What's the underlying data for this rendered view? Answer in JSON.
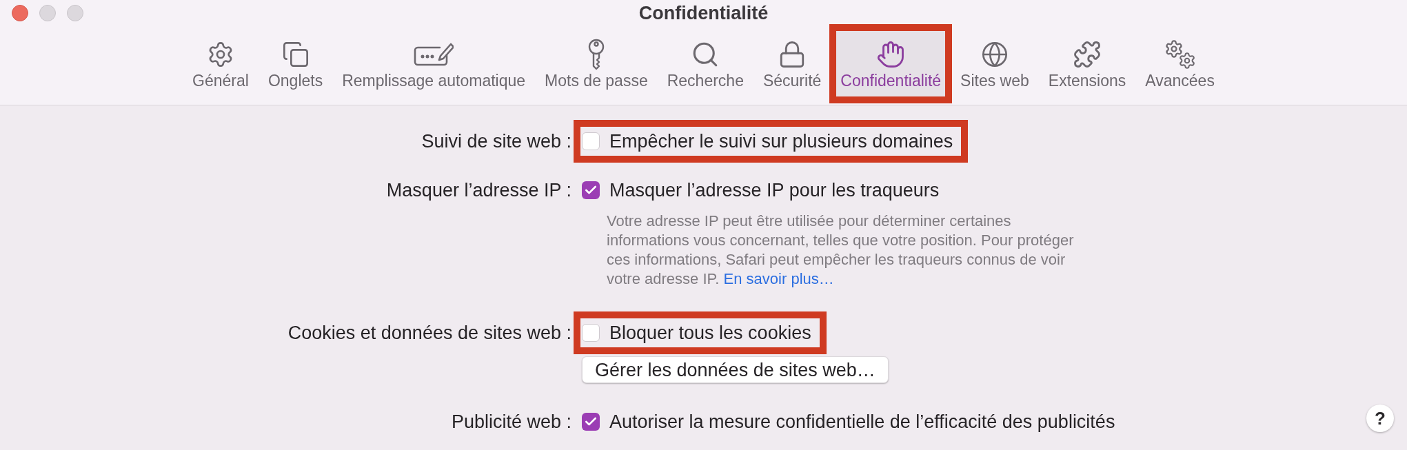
{
  "window": {
    "title": "Confidentialité"
  },
  "toolbar": {
    "tabs": [
      {
        "label": "Général",
        "selected": false,
        "highlighted": false
      },
      {
        "label": "Onglets",
        "selected": false,
        "highlighted": false
      },
      {
        "label": "Remplissage automatique",
        "selected": false,
        "highlighted": false
      },
      {
        "label": "Mots de passe",
        "selected": false,
        "highlighted": false
      },
      {
        "label": "Recherche",
        "selected": false,
        "highlighted": false
      },
      {
        "label": "Sécurité",
        "selected": false,
        "highlighted": false
      },
      {
        "label": "Confidentialité",
        "selected": true,
        "highlighted": true
      },
      {
        "label": "Sites web",
        "selected": false,
        "highlighted": false
      },
      {
        "label": "Extensions",
        "selected": false,
        "highlighted": false
      },
      {
        "label": "Avancées",
        "selected": false,
        "highlighted": false
      }
    ]
  },
  "settings": [
    {
      "label": "Suivi de site web :",
      "options": [
        {
          "kind": "checkbox",
          "label": "Empêcher le suivi sur plusieurs domaines",
          "checked": false,
          "highlighted": true
        }
      ]
    },
    {
      "label": "Masquer l’adresse IP :",
      "options": [
        {
          "kind": "checkbox",
          "label": "Masquer l’adresse IP pour les traqueurs",
          "checked": true,
          "highlighted": false
        },
        {
          "kind": "note",
          "lines": [
            "Votre adresse IP peut être utilisée pour déterminer certaines",
            "informations vous concernant, telles que votre position. Pour protéger",
            "ces informations, Safari peut empêcher les traqueurs connus de voir",
            "votre adresse IP."
          ],
          "link": "En savoir plus…"
        }
      ]
    },
    {
      "label": "Cookies et données de sites web :",
      "options": [
        {
          "kind": "checkbox",
          "label": "Bloquer tous les cookies",
          "checked": false,
          "highlighted": true
        },
        {
          "kind": "button",
          "label": "Gérer les données de sites web…"
        }
      ]
    },
    {
      "label": "Publicité web :",
      "options": [
        {
          "kind": "checkbox",
          "label": "Autoriser la mesure confidentielle de l’efficacité des publicités",
          "checked": true,
          "highlighted": false
        }
      ]
    }
  ],
  "help_button": {
    "label": "?"
  }
}
